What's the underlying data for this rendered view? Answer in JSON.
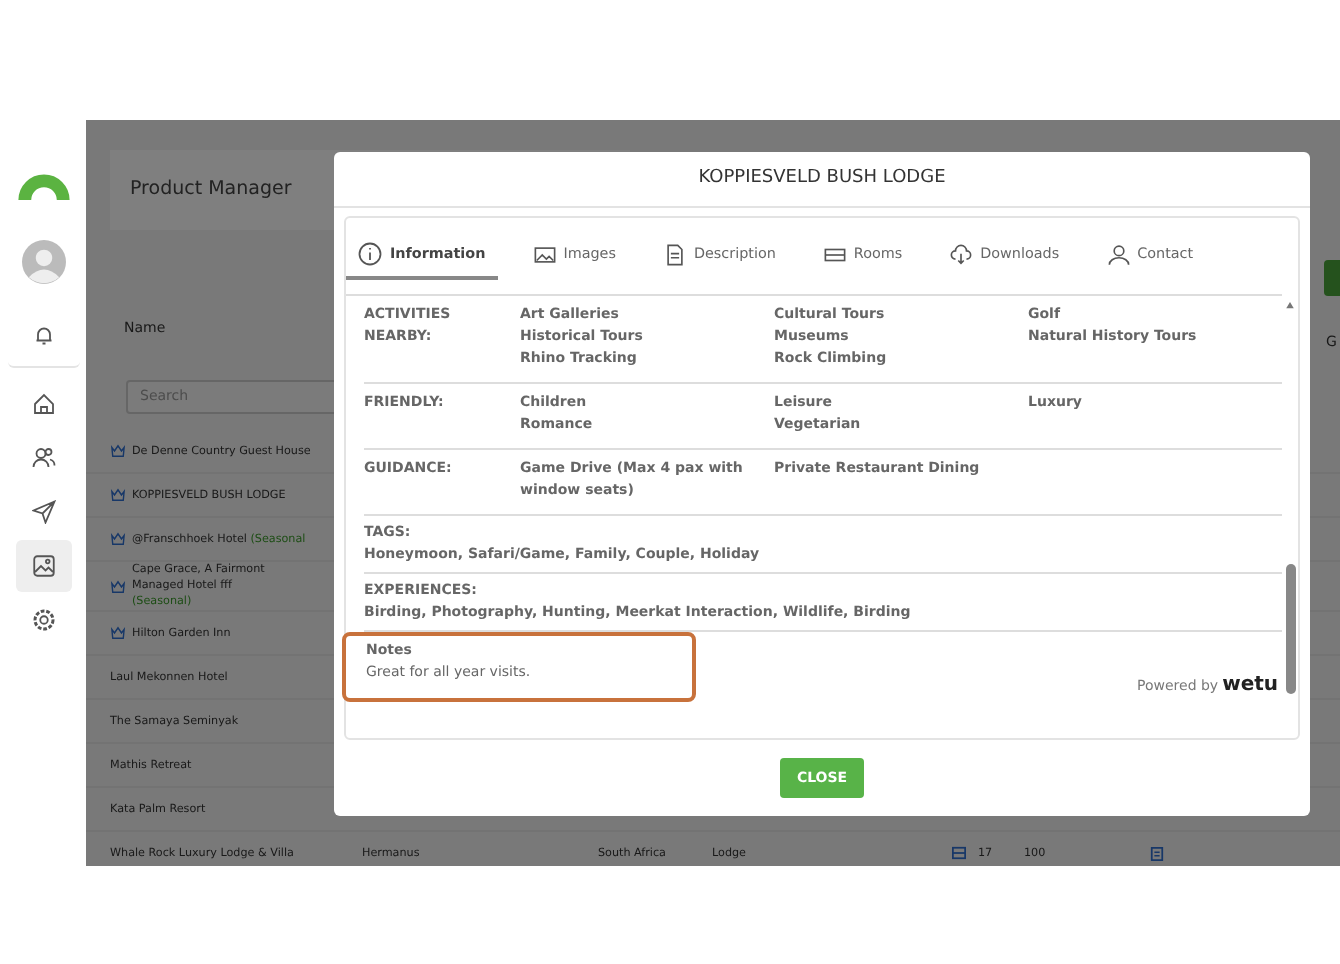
{
  "sidebar": {
    "items": [
      {
        "kind": "logo",
        "selected": false
      },
      {
        "kind": "avatar",
        "selected": false
      },
      {
        "kind": "bell",
        "selected": false
      },
      {
        "kind": "home",
        "selected": false
      },
      {
        "kind": "users",
        "selected": false
      },
      {
        "kind": "send",
        "selected": false
      },
      {
        "kind": "image",
        "selected": true
      },
      {
        "kind": "gear",
        "selected": false
      }
    ]
  },
  "app": {
    "title": "Product Manager",
    "columns": [
      "Name",
      "G"
    ],
    "search": {
      "placeholder": "Search"
    },
    "rows": [
      {
        "name": "De Denne Country Guest House",
        "featured": true
      },
      {
        "name": "KOPPIESVELD BUSH LODGE",
        "featured": true
      },
      {
        "name": "@Franschhoek Hotel",
        "featured": true,
        "tag": "(Seasonal"
      },
      {
        "name": "Cape Grace, A Fairmont Managed Hotel fff",
        "featured": true,
        "tag": "(Seasonal)"
      },
      {
        "name": "Hilton Garden Inn",
        "featured": true
      },
      {
        "name": "Laul Mekonnen Hotel",
        "featured": false
      },
      {
        "name": "The Samaya Seminyak",
        "featured": false
      },
      {
        "name": "Mathis Retreat",
        "featured": false
      },
      {
        "name": "Kata Palm Resort",
        "featured": false
      },
      {
        "name": "Whale Rock Luxury Lodge & Villa",
        "featured": false,
        "cells": [
          "Hermanus",
          "South Africa",
          "Lodge",
          "17",
          "100"
        ]
      }
    ]
  },
  "modal": {
    "title": "KOPPIESVELD BUSH LODGE",
    "tabs": [
      {
        "label": "Information",
        "kind": "info",
        "selected": true
      },
      {
        "label": "Images",
        "kind": "image",
        "selected": false
      },
      {
        "label": "Description",
        "kind": "document",
        "selected": false
      },
      {
        "label": "Rooms",
        "kind": "rooms",
        "selected": false
      },
      {
        "label": "Downloads",
        "kind": "cloud",
        "selected": false
      },
      {
        "label": "Contact",
        "kind": "person",
        "selected": false
      }
    ],
    "sections": [
      {
        "kind": "grid",
        "label": "ACTIVITIES NEARBY:",
        "columns": [
          [
            "Art Galleries",
            "Historical Tours",
            "Rhino Tracking"
          ],
          [
            "Cultural Tours",
            "Museums",
            "Rock Climbing"
          ],
          [
            "Golf",
            "Natural History Tours"
          ]
        ]
      },
      {
        "kind": "grid",
        "label": "FRIENDLY:",
        "columns": [
          [
            "Children",
            "Romance"
          ],
          [
            "Leisure",
            "Vegetarian"
          ],
          [
            "Luxury"
          ]
        ]
      },
      {
        "kind": "grid",
        "label": "GUIDANCE:",
        "columns": [
          [
            "Game Drive (Max 4 pax with window seats)"
          ],
          [
            "Private Restaurant Dining"
          ]
        ]
      },
      {
        "kind": "text",
        "label": "TAGS:",
        "text": "Honeymoon, Safari/Game, Family, Couple, Holiday"
      },
      {
        "kind": "text",
        "label": "EXPERIENCES:",
        "text": "Birding, Photography, Hunting, Meerkat Interaction, Wildlife, Birding"
      }
    ],
    "notes": {
      "label": "Notes",
      "text": "Great for all year visits.",
      "highlighted": true
    },
    "powered_by": {
      "text": "Powered by",
      "brand": "wetu"
    },
    "close_button": "CLOSE"
  }
}
